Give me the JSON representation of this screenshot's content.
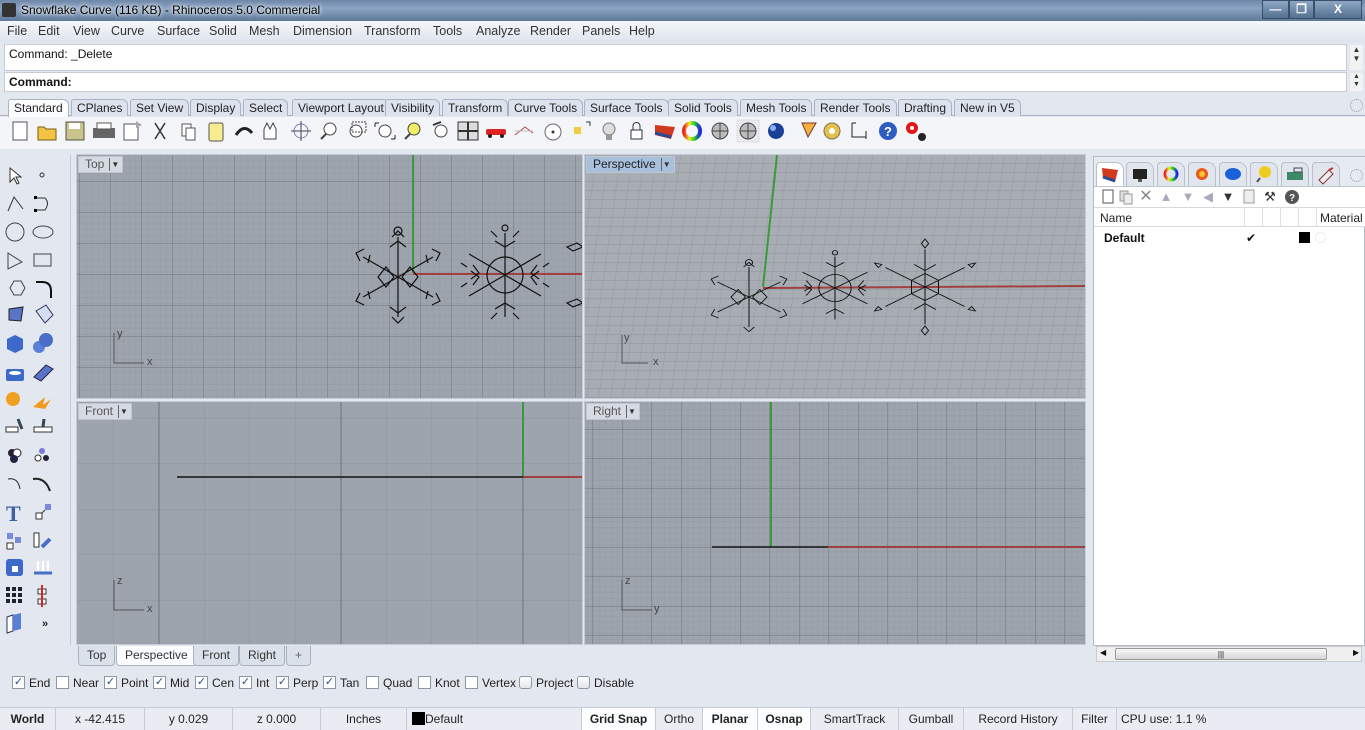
{
  "window": {
    "title": "Snowflake Curve (116 KB) - Rhinoceros 5.0 Commercial",
    "controls": {
      "minimize": "—",
      "restore": "❐",
      "close": "X"
    }
  },
  "menu": [
    "File",
    "Edit",
    "View",
    "Curve",
    "Surface",
    "Solid",
    "Mesh",
    "Dimension",
    "Transform",
    "Tools",
    "Analyze",
    "Render",
    "Panels",
    "Help"
  ],
  "command": {
    "history": "Command: _Delete",
    "prompt": "Command:",
    "input_value": ""
  },
  "toolbar_tabs": [
    {
      "label": "Standard",
      "active": true
    },
    {
      "label": "CPlanes"
    },
    {
      "label": "Set View"
    },
    {
      "label": "Display"
    },
    {
      "label": "Select"
    },
    {
      "label": "Viewport Layout"
    },
    {
      "label": "Visibility"
    },
    {
      "label": "Transform"
    },
    {
      "label": "Curve Tools"
    },
    {
      "label": "Surface Tools"
    },
    {
      "label": "Solid Tools"
    },
    {
      "label": "Mesh Tools"
    },
    {
      "label": "Render Tools"
    },
    {
      "label": "Drafting"
    },
    {
      "label": "New in V5"
    }
  ],
  "toolbar_icons": [
    "new-icon",
    "open-icon",
    "save-icon",
    "print-icon",
    "import-icon",
    "cut-icon",
    "copy-icon",
    "paste-icon",
    "undo-icon",
    "pan-icon",
    "rotate-view-icon",
    "zoom-dynamic-icon",
    "zoom-window-icon",
    "zoom-extents-icon",
    "zoom-selected-icon",
    "undo-view-icon",
    "four-viewports-icon",
    "car-icon",
    "grid-options-icon",
    "cplane-icon",
    "select-points-icon",
    "light-icon",
    "lock-icon",
    "layer-icon",
    "color-wheel-icon",
    "wireframe-sphere-icon",
    "shaded-sphere-icon",
    "rendered-sphere-icon",
    "render-icon",
    "options-gear-icon",
    "dimension-icon",
    "help-icon",
    "settings-gear-icon"
  ],
  "sidebar_icons": [
    "select-icon",
    "point-icon",
    "polyline-icon",
    "curve-control-points-icon",
    "circle-icon",
    "ellipse-icon",
    "arc-icon",
    "rectangle-icon",
    "polygon-icon",
    "fillet-curve-icon",
    "surface-points-icon",
    "surface-edge-icon",
    "box-icon",
    "sphere-union-icon",
    "extrude-icon",
    "surface-mesh-icon",
    "explode-icon",
    "trim-icon",
    "split-icon",
    "join-icon",
    "boolean-icon",
    "group-icon",
    "offset-curve-icon",
    "curve-arc-icon",
    "text-icon",
    "scale-icon",
    "array-icon",
    "move-icon",
    "solid-box-icon",
    "dimension-line-icon",
    "grid-array-icon",
    "mirror-icon",
    "flip-icon",
    "more-tools-icon"
  ],
  "viewports": [
    {
      "name": "Top",
      "active": false,
      "axis_labels": [
        "y",
        "x"
      ]
    },
    {
      "name": "Perspective",
      "active": true,
      "axis_labels": [
        "y",
        "x"
      ]
    },
    {
      "name": "Front",
      "active": false,
      "axis_labels": [
        "z",
        "x"
      ]
    },
    {
      "name": "Right",
      "active": false,
      "axis_labels": [
        "z",
        "y"
      ]
    }
  ],
  "viewport_tabs": [
    {
      "label": "Top"
    },
    {
      "label": "Perspective",
      "active": true
    },
    {
      "label": "Front"
    },
    {
      "label": "Right"
    },
    {
      "label": "+"
    }
  ],
  "layers_panel": {
    "tab_icons": [
      "layers-icon",
      "display-icon",
      "color-icon",
      "sun-icon",
      "material-icon",
      "light-icon",
      "keyboard-icon",
      "named-view-icon",
      "settings-icon"
    ],
    "tools": [
      "new-layer-icon",
      "new-sublayer-icon",
      "delete-icon",
      "move-up-icon",
      "move-down-icon",
      "move-left-icon",
      "filter-icon",
      "copy-icon",
      "tools-hammer-icon",
      "help-icon"
    ],
    "columns": [
      "Name",
      "Material"
    ],
    "rows": [
      {
        "name": "Default",
        "current": "✔",
        "color": "#000000"
      }
    ]
  },
  "osnap": [
    {
      "label": "End",
      "checked": true
    },
    {
      "label": "Near",
      "checked": false
    },
    {
      "label": "Point",
      "checked": true
    },
    {
      "label": "Mid",
      "checked": true
    },
    {
      "label": "Cen",
      "checked": true
    },
    {
      "label": "Int",
      "checked": true
    },
    {
      "label": "Perp",
      "checked": true
    },
    {
      "label": "Tan",
      "checked": true
    },
    {
      "label": "Quad",
      "checked": false
    },
    {
      "label": "Knot",
      "checked": false
    },
    {
      "label": "Vertex",
      "checked": false
    },
    {
      "label": "Project",
      "checked": false,
      "button": true
    },
    {
      "label": "Disable",
      "checked": false,
      "button": true
    }
  ],
  "status": {
    "cplane": "World",
    "x": "x -42.415",
    "y": "y 0.029",
    "z": "z 0.000",
    "units": "Inches",
    "layer": "Default",
    "layer_color": "#000000",
    "toggles": [
      {
        "label": "Grid Snap",
        "on": true
      },
      {
        "label": "Ortho",
        "on": false
      },
      {
        "label": "Planar",
        "on": true
      },
      {
        "label": "Osnap",
        "on": true
      },
      {
        "label": "SmartTrack",
        "on": false
      },
      {
        "label": "Gumball",
        "on": false
      },
      {
        "label": "Record History",
        "on": false
      },
      {
        "label": "Filter",
        "on": false
      }
    ],
    "cpu": "CPU use: 1.1 %"
  },
  "colors": {
    "x_axis": "#a04040",
    "y_axis": "#3a9a3a",
    "grid_bg": "#9ea4ad",
    "active_label": "#a9c0dc"
  }
}
